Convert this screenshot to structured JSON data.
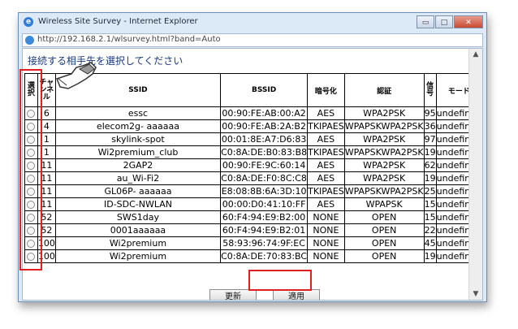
{
  "window": {
    "title": "Wireless Site Survey - Internet Explorer",
    "address": "http://192.168.2.1/wlsurvey.html?band=Auto",
    "buttons": {
      "minimize": "▭",
      "maximize": "□",
      "close": "✕"
    }
  },
  "page": {
    "heading": "接続する相手先を選択してください",
    "table": {
      "headers": {
        "select": "選択",
        "channel": "チャンネル",
        "ssid": "SSID",
        "bssid": "BSSID",
        "encryption": "暗号化",
        "auth": "認証",
        "signal": "信号",
        "mode": "モード"
      },
      "rows": [
        {
          "ch": "6",
          "ssid": "essc",
          "bssid": "00:90:FE:AB:00:A2",
          "enc": "AES",
          "auth": "WPA2PSK",
          "sig": "95",
          "mode": "undefined"
        },
        {
          "ch": "4",
          "ssid": "elecom2g- aaaaaa",
          "bssid": "00:90:FE:AB:2A:B2",
          "enc": "TKIPAES",
          "auth": "WPAPSKWPA2PSK",
          "sig": "36",
          "mode": "undefined"
        },
        {
          "ch": "1",
          "ssid": "skylink-spot",
          "bssid": "00:01:8E:A7:D6:83",
          "enc": "AES",
          "auth": "WPA2PSK",
          "sig": "97",
          "mode": "undefined"
        },
        {
          "ch": "1",
          "ssid": "Wi2premium_club",
          "bssid": "C0:8A:DE:B0:83:B8",
          "enc": "TKIPAES",
          "auth": "WPAPSKWPA2PSK",
          "sig": "19",
          "mode": "undefined"
        },
        {
          "ch": "11",
          "ssid": "2GAP2",
          "bssid": "00:90:FE:9C:60:14",
          "enc": "AES",
          "auth": "WPA2PSK",
          "sig": "62",
          "mode": "undefined"
        },
        {
          "ch": "11",
          "ssid": "au_Wi-Fi2",
          "bssid": "C0:8A:DE:F0:8C:C8",
          "enc": "AES",
          "auth": "WPA2PSK",
          "sig": "19",
          "mode": "undefined"
        },
        {
          "ch": "11",
          "ssid": "GL06P- aaaaaa",
          "bssid": "E8:08:8B:6A:3D:10",
          "enc": "TKIPAES",
          "auth": "WPAPSKWPA2PSK",
          "sig": "25",
          "mode": "undefined"
        },
        {
          "ch": "11",
          "ssid": "ID-SDC-NWLAN",
          "bssid": "00:00:D0:41:10:FF",
          "enc": "AES",
          "auth": "WPAPSK",
          "sig": "15",
          "mode": "undefined"
        },
        {
          "ch": "52",
          "ssid": "SWS1day",
          "bssid": "60:F4:94:E9:B2:00",
          "enc": "NONE",
          "auth": "OPEN",
          "sig": "15",
          "mode": "undefined"
        },
        {
          "ch": "52",
          "ssid": "0001aaaaaa",
          "bssid": "60:F4:94:E9:B2:01",
          "enc": "NONE",
          "auth": "OPEN",
          "sig": "22",
          "mode": "undefined"
        },
        {
          "ch": "100",
          "ssid": "Wi2premium",
          "bssid": "58:93:96:74:9F:EC",
          "enc": "NONE",
          "auth": "OPEN",
          "sig": "45",
          "mode": "undefined"
        },
        {
          "ch": "100",
          "ssid": "Wi2premium",
          "bssid": "C0:8A:DE:70:83:BC",
          "enc": "NONE",
          "auth": "OPEN",
          "sig": "19",
          "mode": "undefined"
        }
      ]
    },
    "buttons": {
      "refresh": "更新",
      "apply": "適用"
    }
  },
  "colors": {
    "highlight": "#e02020",
    "window_frame": "#dce9f7"
  }
}
